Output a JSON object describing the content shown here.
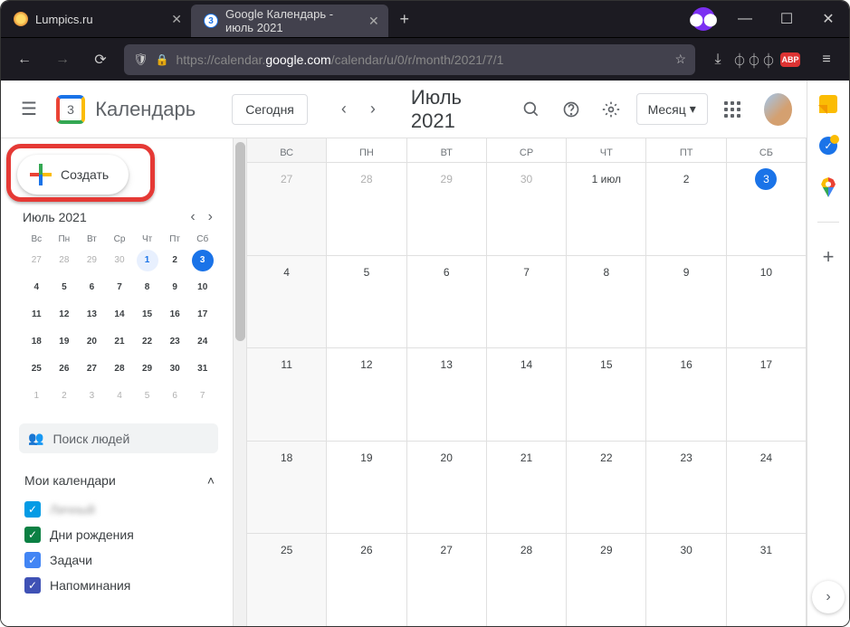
{
  "browser": {
    "tabs": [
      {
        "title": "Lumpics.ru",
        "active": false
      },
      {
        "title": "Google Календарь - июль 2021",
        "active": true
      }
    ],
    "url_prefix": "https://calendar.",
    "url_host": "google.com",
    "url_path": "/calendar/u/0/r/month/2021/7/1",
    "abp": "ABP"
  },
  "header": {
    "logo_day": "3",
    "app_title": "Календарь",
    "today": "Сегодня",
    "month_title": "Июль 2021",
    "view_label": "Месяц"
  },
  "sidebar": {
    "create": "Создать",
    "mini_title": "Июль 2021",
    "day_headers": [
      "Вс",
      "Пн",
      "Вт",
      "Ср",
      "Чт",
      "Пт",
      "Сб"
    ],
    "mini_days": [
      {
        "n": "27",
        "cls": "other"
      },
      {
        "n": "28",
        "cls": "other"
      },
      {
        "n": "29",
        "cls": "other"
      },
      {
        "n": "30",
        "cls": "other"
      },
      {
        "n": "1",
        "cls": "cur today"
      },
      {
        "n": "2",
        "cls": "cur"
      },
      {
        "n": "3",
        "cls": "cur selected"
      },
      {
        "n": "4",
        "cls": "cur"
      },
      {
        "n": "5",
        "cls": "cur"
      },
      {
        "n": "6",
        "cls": "cur"
      },
      {
        "n": "7",
        "cls": "cur"
      },
      {
        "n": "8",
        "cls": "cur"
      },
      {
        "n": "9",
        "cls": "cur"
      },
      {
        "n": "10",
        "cls": "cur"
      },
      {
        "n": "11",
        "cls": "cur"
      },
      {
        "n": "12",
        "cls": "cur"
      },
      {
        "n": "13",
        "cls": "cur"
      },
      {
        "n": "14",
        "cls": "cur"
      },
      {
        "n": "15",
        "cls": "cur"
      },
      {
        "n": "16",
        "cls": "cur"
      },
      {
        "n": "17",
        "cls": "cur"
      },
      {
        "n": "18",
        "cls": "cur"
      },
      {
        "n": "19",
        "cls": "cur"
      },
      {
        "n": "20",
        "cls": "cur"
      },
      {
        "n": "21",
        "cls": "cur"
      },
      {
        "n": "22",
        "cls": "cur"
      },
      {
        "n": "23",
        "cls": "cur"
      },
      {
        "n": "24",
        "cls": "cur"
      },
      {
        "n": "25",
        "cls": "cur"
      },
      {
        "n": "26",
        "cls": "cur"
      },
      {
        "n": "27",
        "cls": "cur"
      },
      {
        "n": "28",
        "cls": "cur"
      },
      {
        "n": "29",
        "cls": "cur"
      },
      {
        "n": "30",
        "cls": "cur"
      },
      {
        "n": "31",
        "cls": "cur"
      },
      {
        "n": "1",
        "cls": "other"
      },
      {
        "n": "2",
        "cls": "other"
      },
      {
        "n": "3",
        "cls": "other"
      },
      {
        "n": "4",
        "cls": "other"
      },
      {
        "n": "5",
        "cls": "other"
      },
      {
        "n": "6",
        "cls": "other"
      },
      {
        "n": "7",
        "cls": "other"
      }
    ],
    "search_placeholder": "Поиск людей",
    "my_calendars": "Мои календари",
    "calendars": [
      {
        "label": "Личный",
        "color": "#039be5",
        "blur": true
      },
      {
        "label": "Дни рождения",
        "color": "#0b8043",
        "blur": false
      },
      {
        "label": "Задачи",
        "color": "#4285f4",
        "blur": false
      },
      {
        "label": "Напоминания",
        "color": "#3f51b5",
        "blur": false
      }
    ]
  },
  "grid": {
    "headers": [
      "ВС",
      "ПН",
      "ВТ",
      "СР",
      "ЧТ",
      "ПТ",
      "СБ"
    ],
    "weeks": [
      [
        {
          "n": "27",
          "cls": "other sun"
        },
        {
          "n": "28",
          "cls": "other"
        },
        {
          "n": "29",
          "cls": "other"
        },
        {
          "n": "30",
          "cls": "other"
        },
        {
          "n": "1 июл",
          "cls": "today"
        },
        {
          "n": "2",
          "cls": ""
        },
        {
          "n": "3",
          "cls": "sel"
        }
      ],
      [
        {
          "n": "4",
          "cls": "sun"
        },
        {
          "n": "5",
          "cls": ""
        },
        {
          "n": "6",
          "cls": ""
        },
        {
          "n": "7",
          "cls": ""
        },
        {
          "n": "8",
          "cls": ""
        },
        {
          "n": "9",
          "cls": ""
        },
        {
          "n": "10",
          "cls": ""
        }
      ],
      [
        {
          "n": "11",
          "cls": "sun"
        },
        {
          "n": "12",
          "cls": ""
        },
        {
          "n": "13",
          "cls": ""
        },
        {
          "n": "14",
          "cls": ""
        },
        {
          "n": "15",
          "cls": ""
        },
        {
          "n": "16",
          "cls": ""
        },
        {
          "n": "17",
          "cls": ""
        }
      ],
      [
        {
          "n": "18",
          "cls": "sun"
        },
        {
          "n": "19",
          "cls": ""
        },
        {
          "n": "20",
          "cls": ""
        },
        {
          "n": "21",
          "cls": ""
        },
        {
          "n": "22",
          "cls": ""
        },
        {
          "n": "23",
          "cls": ""
        },
        {
          "n": "24",
          "cls": ""
        }
      ],
      [
        {
          "n": "25",
          "cls": "sun"
        },
        {
          "n": "26",
          "cls": ""
        },
        {
          "n": "27",
          "cls": ""
        },
        {
          "n": "28",
          "cls": ""
        },
        {
          "n": "29",
          "cls": ""
        },
        {
          "n": "30",
          "cls": ""
        },
        {
          "n": "31",
          "cls": ""
        }
      ]
    ]
  }
}
